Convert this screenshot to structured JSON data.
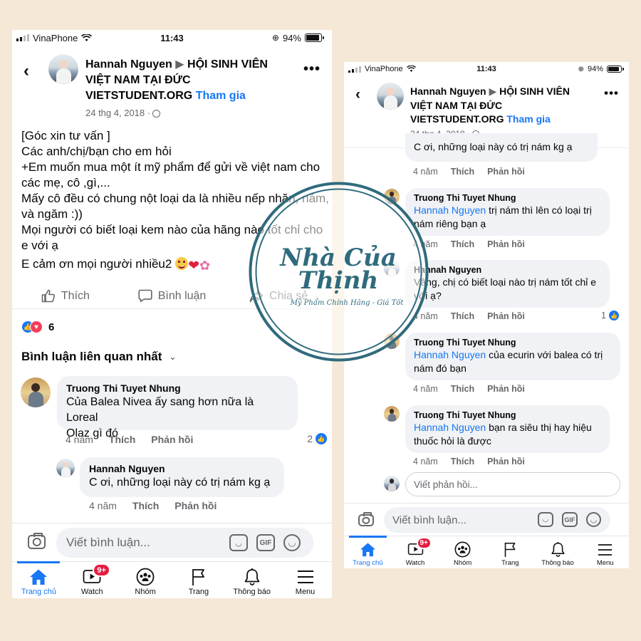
{
  "status": {
    "carrier": "VinaPhone",
    "time": "11:43",
    "battery": "94%"
  },
  "header": {
    "user": "Hannah Nguyen",
    "arrow": "▶",
    "group_line1": "HỘI SINH VIÊN",
    "group_line2": "VIỆT NAM TẠI ĐỨC",
    "group_line3": "VIETSTUDENT.ORG",
    "join": "Tham gia",
    "date": "24 thg 4, 2018 ·"
  },
  "post": {
    "lines": [
      "[Góc xin tư vấn ]",
      "Các anh/chị/bạn cho em hỏi",
      "+Em muốn mua một ít mỹ phẩm để gửi về việt nam cho",
      "các mẹ, cô ,gì,...",
      "Mấy cô đều có chung nột loại da là nhiều nếp nhăn, nám,",
      "và ngăm :))",
      "Mọi người có biết loại kem nào của hãng nào tốt chỉ cho",
      "e với ạ"
    ],
    "last_line": "E cảm ơn  mọi người nhiều2",
    "emojis": [
      "😊",
      "❤",
      "💐"
    ]
  },
  "actions": {
    "like": "Thích",
    "comment": "Bình luận",
    "share": "Chia sẻ"
  },
  "reactions": {
    "count": "6"
  },
  "comments_header": "Bình luận liên quan nhất",
  "left_comments": [
    {
      "author": "Truong Thi Tuyet Nhung",
      "text1": "Của Balea Nivea ấy sang hơn nữa là Loreal",
      "text2": "Olaz gì đó",
      "age": "4 năm",
      "like": "Thích",
      "reply": "Phản hồi",
      "likes": "2"
    },
    {
      "author": "Hannah Nguyen",
      "text1": "C ơi, những loại này có trị nám kg ạ",
      "age": "4 năm",
      "like": "Thích",
      "reply": "Phản hồi"
    }
  ],
  "right_comments": [
    {
      "text1": "C ơi, những loại này có trị nám kg ạ",
      "age": "4 năm",
      "like": "Thích",
      "reply": "Phản hồi"
    },
    {
      "author": "Truong Thi Tuyet Nhung",
      "mention": "Hannah Nguyen",
      "text1": " trị nám thì lên có loại trị",
      "text2": "nám riêng bạn ạ",
      "age": "4 năm",
      "like": "Thích",
      "reply": "Phản hồi"
    },
    {
      "author": "Hannah Nguyen",
      "text1": "Vâng, chị có biết loại nào trị nám tốt chỉ e",
      "text2": "với ạ?",
      "age": "4 năm",
      "like": "Thích",
      "reply": "Phản hồi",
      "likes": "1"
    },
    {
      "author": "Truong Thi Tuyet Nhung",
      "mention": "Hannah Nguyen",
      "text1": " của ecurin với balea có trị",
      "text2": "nám đó bạn",
      "age": "4 năm",
      "like": "Thích",
      "reply": "Phản hồi"
    },
    {
      "author": "Truong Thi Tuyet Nhung",
      "mention": "Hannah Nguyen",
      "text1": " bạn ra siêu thị hay hiệu",
      "text2": "thuốc hỏi là được",
      "age": "4 năm",
      "like": "Thích",
      "reply": "Phản hồi"
    }
  ],
  "reply_placeholder": "Viết phản hồi...",
  "composer": {
    "placeholder": "Viết bình luận...",
    "gif": "GIF"
  },
  "tabs": [
    {
      "label": "Trang chủ",
      "icon": "home-icon"
    },
    {
      "label": "Watch",
      "icon": "watch-icon",
      "badge": "9+"
    },
    {
      "label": "Nhóm",
      "icon": "groups-icon"
    },
    {
      "label": "Trang",
      "icon": "flag-icon"
    },
    {
      "label": "Thông báo",
      "icon": "bell-icon"
    },
    {
      "label": "Menu",
      "icon": "menu-icon"
    }
  ],
  "watermark": {
    "line1": "Nhà Của",
    "line2": "Thịnh",
    "tagline": "Mỹ Phẩm Chính Hãng - Giá Tốt"
  },
  "colors": {
    "accent": "#1877f2",
    "background": "#f6e8d6",
    "watermark": "#2f6b7c",
    "badge": "#e41e3f"
  }
}
